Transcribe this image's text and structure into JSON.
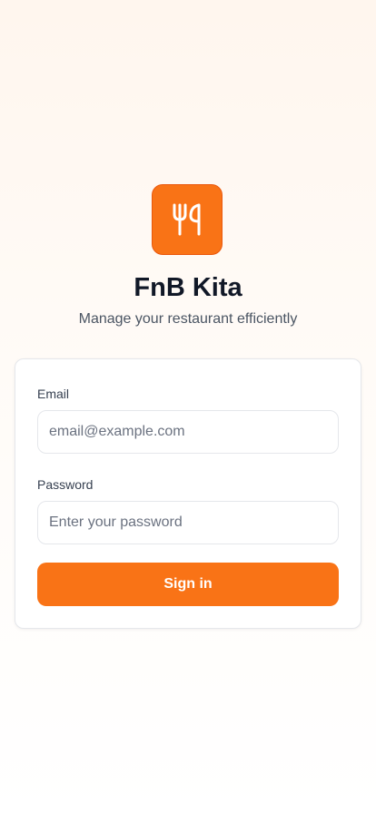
{
  "app": {
    "title": "FnB Kita",
    "subtitle": "Manage your restaurant efficiently",
    "logo_icon": "utensils-icon",
    "accent_color": "#f97316"
  },
  "login_form": {
    "email": {
      "label": "Email",
      "value": "",
      "placeholder": "email@example.com"
    },
    "password": {
      "label": "Password",
      "value": "",
      "placeholder": "Enter your password"
    },
    "submit_label": "Sign in"
  }
}
